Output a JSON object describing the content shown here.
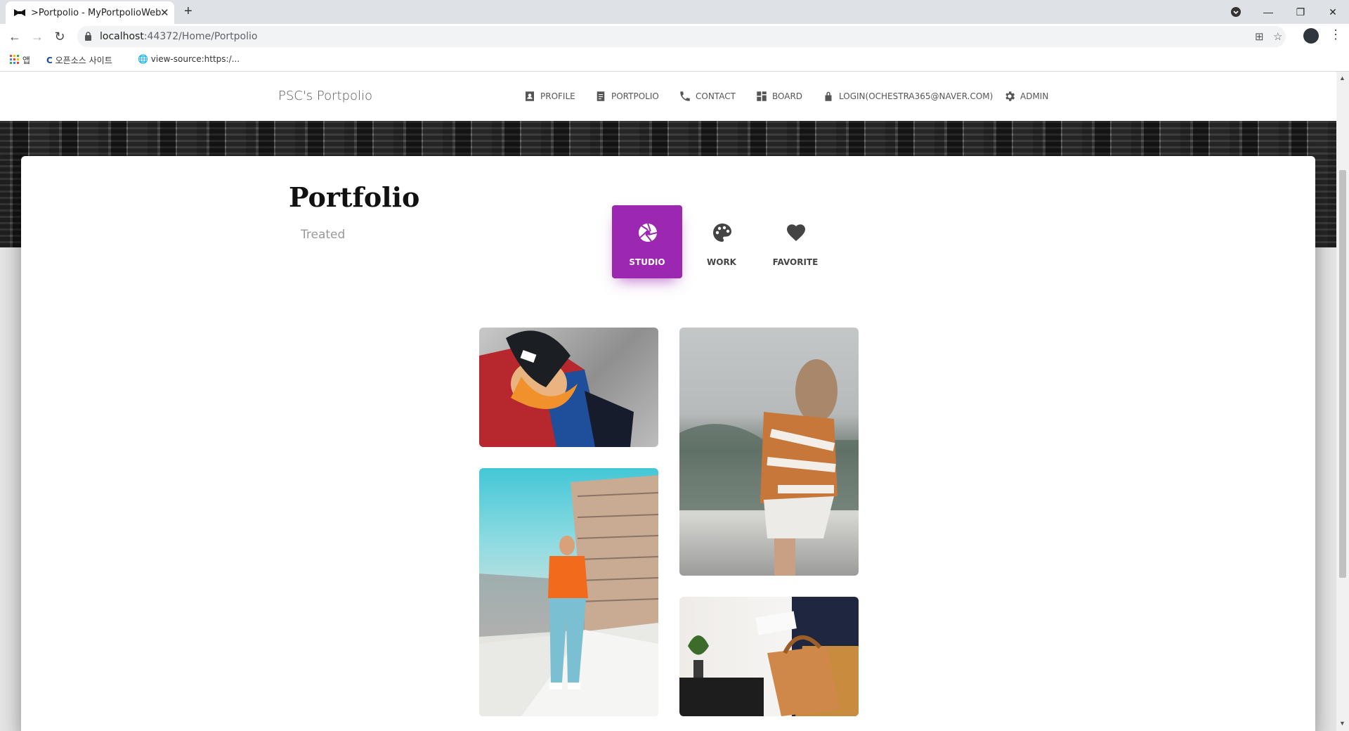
{
  "browser": {
    "tab_title": ">Portpolio - MyPortpolioWeb",
    "url_host": "localhost",
    "url_rest": ":44372/Home/Portpolio",
    "bookmarks": [
      "앱",
      "오픈소스 사이트",
      "view-source:https:/..."
    ]
  },
  "site": {
    "brand": "PSC's Portpolio",
    "nav": [
      {
        "label": "PROFILE",
        "icon": "profile-icon"
      },
      {
        "label": "PORTPOLIO",
        "icon": "clipboard-icon"
      },
      {
        "label": "CONTACT",
        "icon": "phone-icon"
      },
      {
        "label": "BOARD",
        "icon": "dashboard-icon"
      },
      {
        "label": "LOGIN(OCHESTRA365@NAVER.COM)",
        "icon": "lock-icon"
      },
      {
        "label": "ADMIN",
        "icon": "gear-icon"
      }
    ]
  },
  "content": {
    "title": "Portfolio",
    "subtitle": "Treated",
    "tabs": [
      {
        "label": "STUDIO",
        "icon": "camera-aperture-icon",
        "active": true
      },
      {
        "label": "WORK",
        "icon": "palette-icon",
        "active": false
      },
      {
        "label": "FAVORITE",
        "icon": "heart-icon",
        "active": false
      }
    ],
    "accent_color": "#9c27b0"
  }
}
